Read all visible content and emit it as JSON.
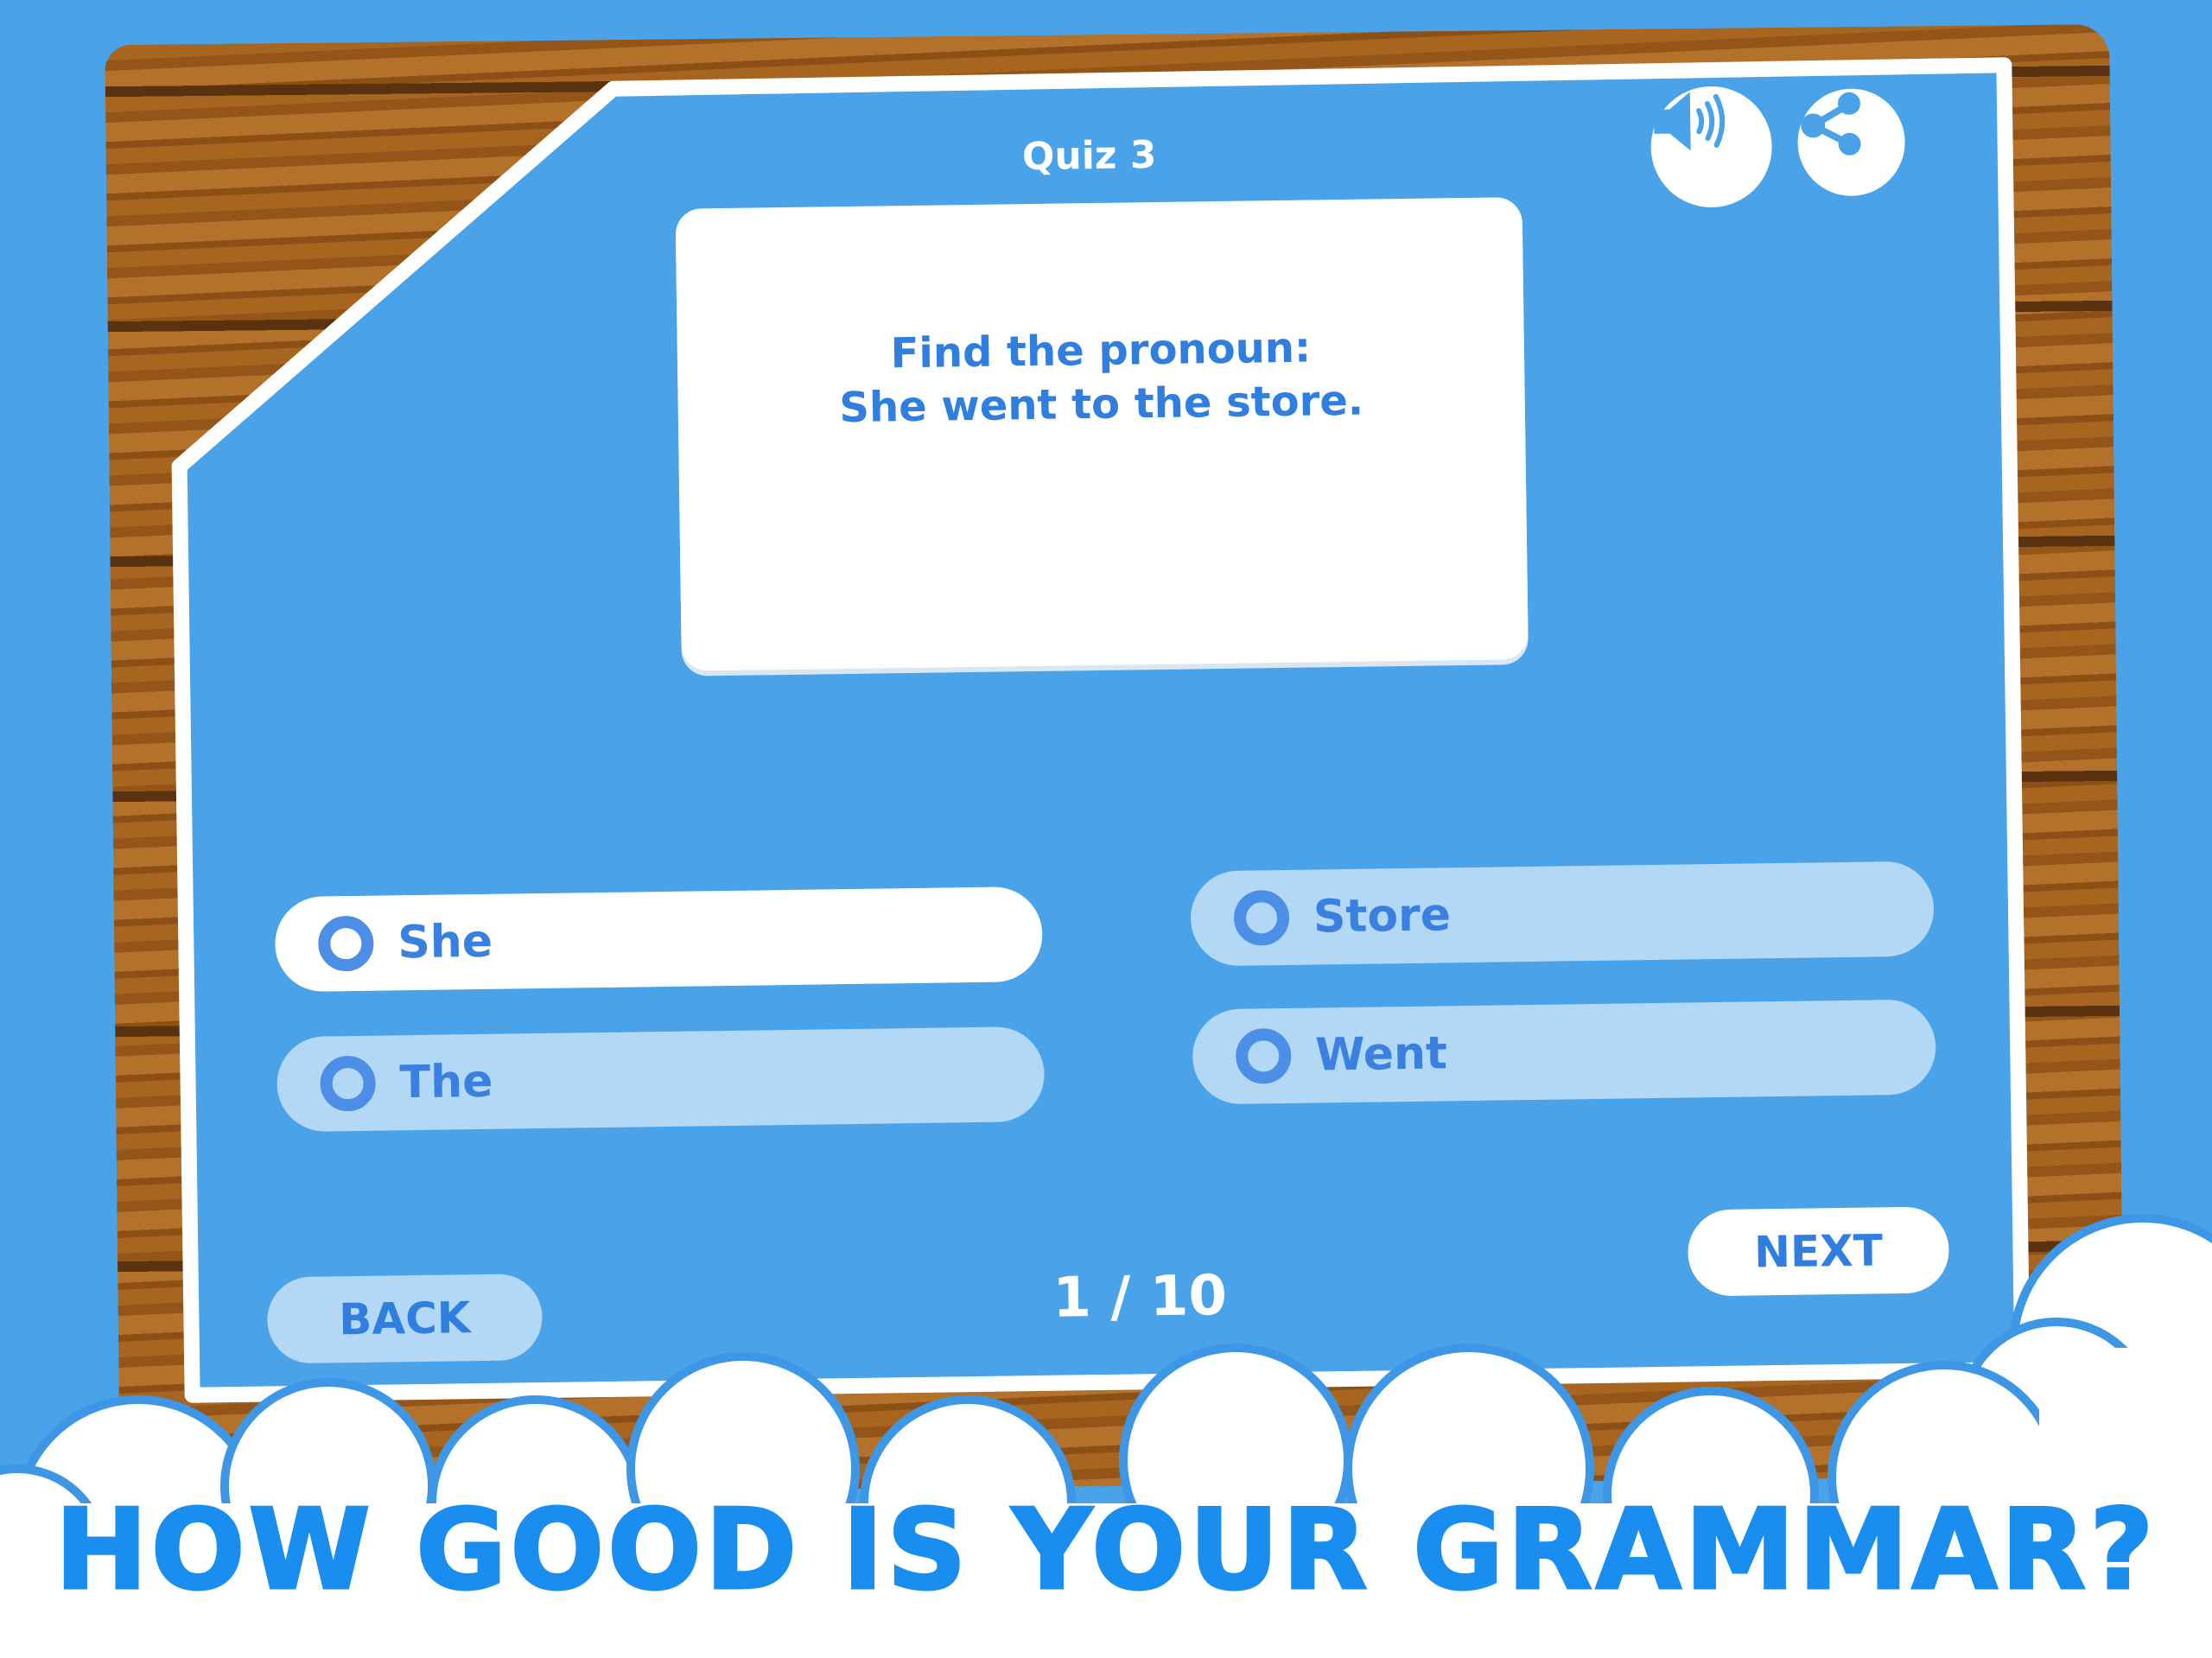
{
  "quiz": {
    "title": "Quiz 3",
    "question": "Find the pronoun:\nShe went to the store.",
    "options": [
      {
        "label": "She",
        "selected": true
      },
      {
        "label": "The",
        "selected": false
      },
      {
        "label": "Store",
        "selected": false
      },
      {
        "label": "Went",
        "selected": false
      }
    ],
    "progress": "1 / 10",
    "back_label": "BACK",
    "next_label": "NEXT",
    "icons": {
      "sound": "speaker-icon",
      "share": "share-icon"
    }
  },
  "headline": "HOW GOOD IS YOUR GRAMMAR?",
  "colors": {
    "background": "#4aa3e8",
    "panel": "#4aa3e8",
    "accent": "#2f7ee0",
    "headline": "#1a8ef0",
    "option_unselected": "#b3d8f6"
  }
}
